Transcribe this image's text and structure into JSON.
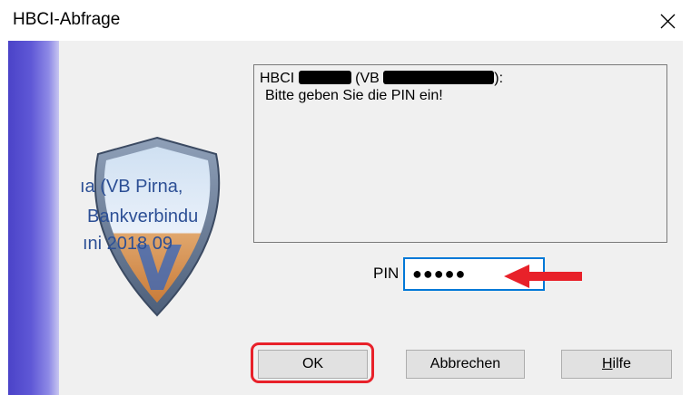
{
  "window": {
    "title": "HBCI-Abfrage",
    "close_icon": "close-icon"
  },
  "logo": {
    "lines": [
      "ıa (VB Pirna,",
      "Bankverbindu",
      "ıni 2018  09"
    ],
    "icon": "shield-logo-icon"
  },
  "message": {
    "line1_prefix": "HBCI ",
    "line1_mid": " (VB ",
    "line1_suffix": "):",
    "line2": "Bitte geben Sie die PIN ein!"
  },
  "pin": {
    "label": "PIN",
    "masked_value": "●●●●●"
  },
  "buttons": {
    "ok": "OK",
    "cancel": "Abbrechen",
    "help_accel": "H",
    "help_rest": "ilfe"
  },
  "colors": {
    "accent_red": "#e8212a",
    "focus_blue": "#0078d7",
    "stripe_blue": "#4b43c8"
  }
}
